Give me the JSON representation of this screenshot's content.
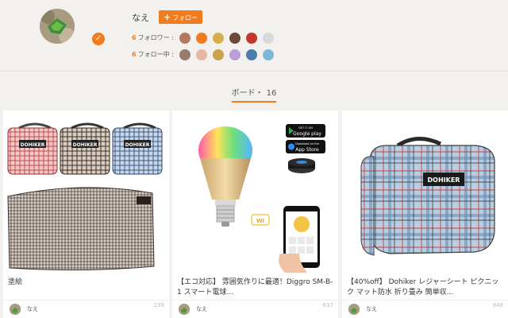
{
  "profile": {
    "name": "なえ",
    "follow_label": "フォロー",
    "followers_count": "6",
    "followers_label": "フォロワー :",
    "following_count": "6",
    "following_label": "フォロー中 :"
  },
  "boards": {
    "tab_label": "ボード",
    "separator": "・",
    "count": "16"
  },
  "cards": [
    {
      "title": "塗絵",
      "user": "なえ",
      "count": "239"
    },
    {
      "title": "【エコ対応】 雰囲気作りに最適！Diggro SM-B-1 スマート電球…",
      "user": "なえ",
      "count": "637"
    },
    {
      "title": "【40%off】 Dohiker レジャーシート ピクニック マット防水 折り畳み 簡単収…",
      "user": "なえ",
      "count": "948"
    }
  ],
  "product": {
    "brand": "DOHIKER",
    "google_play_top": "GET IT ON",
    "google_play": "Google play",
    "app_store_top": "Download on the",
    "app_store": "App Store",
    "wifi": "Wi"
  },
  "colors": {
    "accent": "#f07c20"
  }
}
